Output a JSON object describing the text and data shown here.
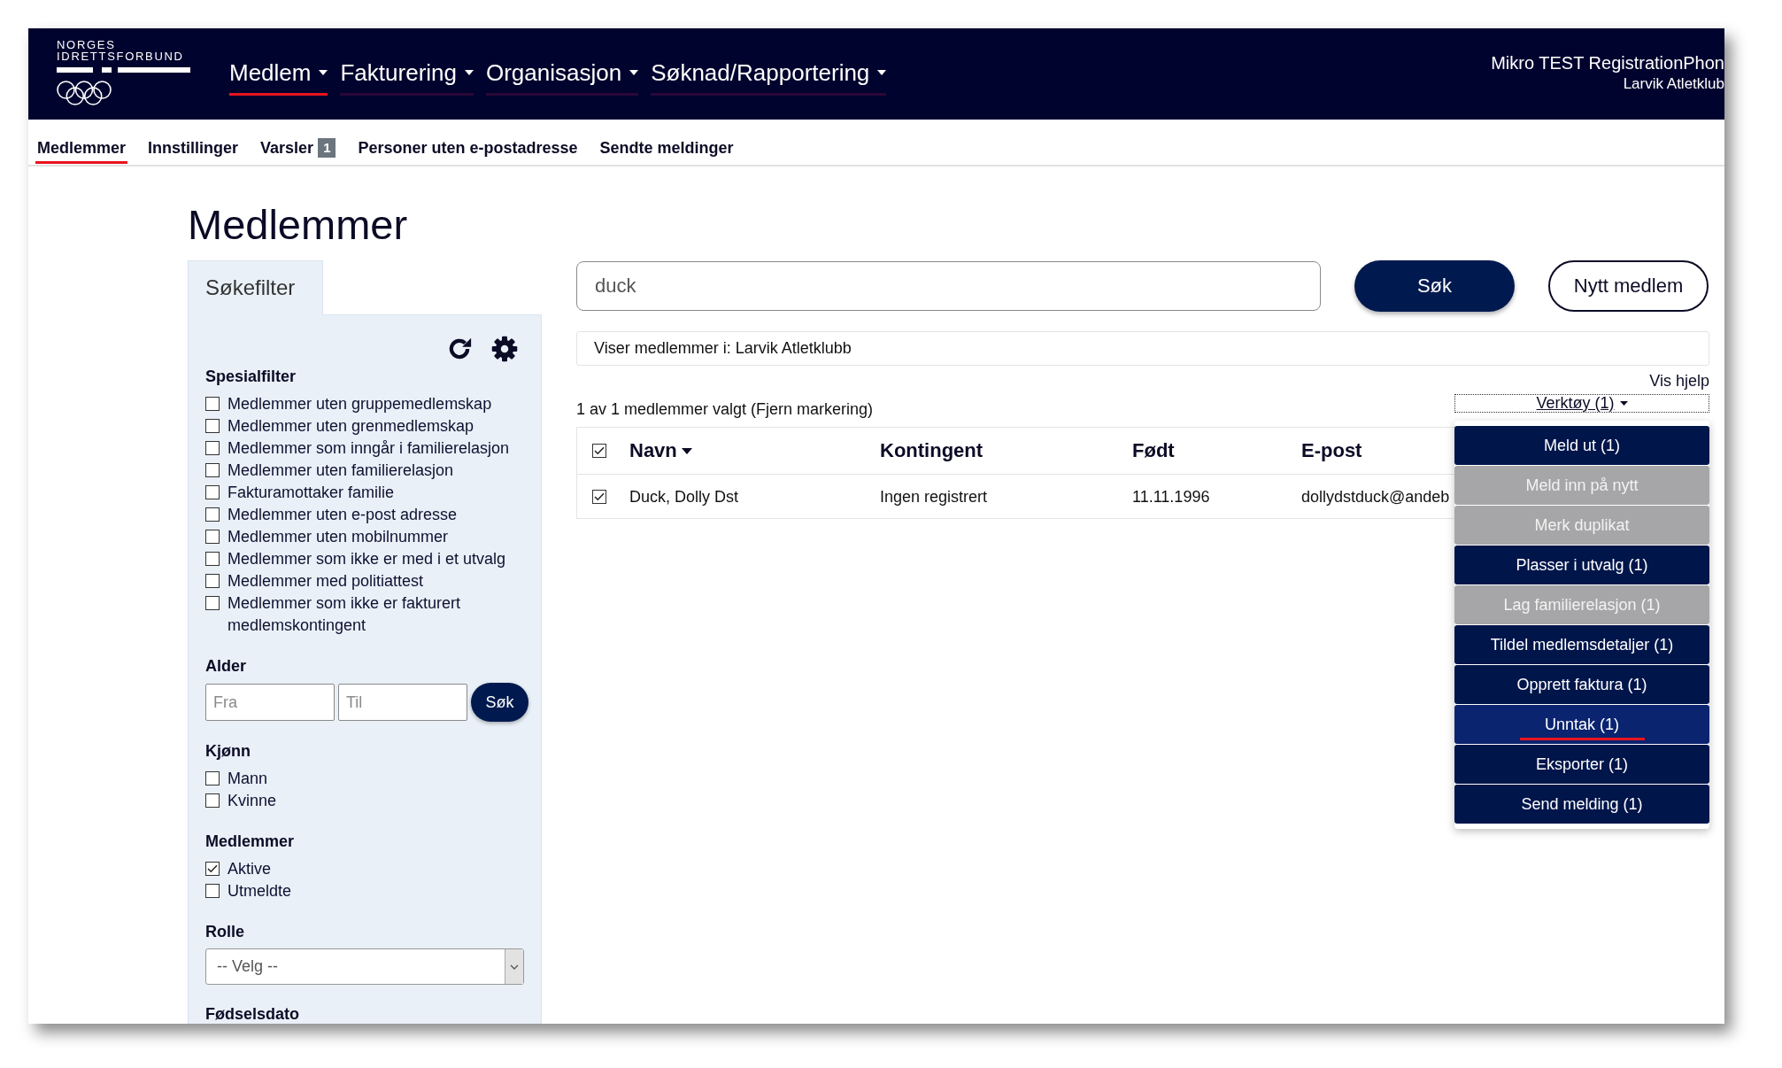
{
  "header": {
    "logo_lines": [
      "NORGES",
      "IDRETTSFORBUND"
    ],
    "nav": [
      {
        "label": "Medlem",
        "selected": true
      },
      {
        "label": "Fakturering",
        "selected": false
      },
      {
        "label": "Organisasjon",
        "selected": false
      },
      {
        "label": "Søknad/Rapportering",
        "selected": false
      }
    ],
    "user_name": "Mikro TEST RegistrationPhon",
    "club_name": "Larvik Atletklub"
  },
  "subnav": [
    {
      "label": "Medlemmer",
      "selected": true
    },
    {
      "label": "Innstillinger",
      "selected": false
    },
    {
      "label": "Varsler",
      "selected": false,
      "badge": "1"
    },
    {
      "label": "Personer uten e-postadresse",
      "selected": false
    },
    {
      "label": "Sendte meldinger",
      "selected": false
    }
  ],
  "page_title": "Medlemmer",
  "filter_panel": {
    "tab": "Søkefilter",
    "sections": [
      {
        "kind": "checkboxes",
        "title": "Spesialfilter",
        "options": [
          {
            "label": "Medlemmer uten gruppemedlemskap",
            "checked": false
          },
          {
            "label": "Medlemmer uten grenmedlemskap",
            "checked": false
          },
          {
            "label": "Medlemmer som inngår i familierelasjon",
            "checked": false
          },
          {
            "label": "Medlemmer uten familierelasjon",
            "checked": false
          },
          {
            "label": "Fakturamottaker familie",
            "checked": false
          },
          {
            "label": "Medlemmer uten e-post adresse",
            "checked": false
          },
          {
            "label": "Medlemmer uten mobilnummer",
            "checked": false
          },
          {
            "label": "Medlemmer som ikke er med i et utvalg",
            "checked": false
          },
          {
            "label": "Medlemmer med politiattest",
            "checked": false
          },
          {
            "label": "Medlemmer som ikke er fakturert medlemskontingent",
            "checked": false
          }
        ]
      },
      {
        "kind": "range",
        "title": "Alder",
        "fields": [
          {
            "placeholder": "Fra"
          },
          {
            "placeholder": "Til"
          }
        ],
        "button": "Søk"
      },
      {
        "kind": "checkboxes",
        "title": "Kjønn",
        "options": [
          {
            "label": "Mann",
            "checked": false
          },
          {
            "label": "Kvinne",
            "checked": false
          }
        ]
      },
      {
        "kind": "checkboxes",
        "title": "Medlemmer",
        "options": [
          {
            "label": "Aktive",
            "checked": true
          },
          {
            "label": "Utmeldte",
            "checked": false
          }
        ]
      },
      {
        "kind": "select",
        "title": "Rolle",
        "value": "-- Velg --"
      },
      {
        "kind": "heading",
        "title": "Fødselsdato"
      }
    ]
  },
  "search": {
    "value": "duck",
    "button": "Søk",
    "new_member_button": "Nytt medlem"
  },
  "scope_notice": "Viser medlemmer i: Larvik Atletklubb",
  "help_link": "Vis hjelp",
  "selection_summary": "1 av 1 medlemmer valgt (Fjern markering)",
  "tools": {
    "label": "Verktøy (1)",
    "expanded": true,
    "items": [
      {
        "label": "Meld ut (1)",
        "disabled": false,
        "selected": false
      },
      {
        "label": "Meld inn på nytt",
        "disabled": true,
        "selected": false
      },
      {
        "label": "Merk duplikat",
        "disabled": true,
        "selected": false
      },
      {
        "label": "Plasser i utvalg (1)",
        "disabled": false,
        "selected": false
      },
      {
        "label": "Lag familierelasjon (1)",
        "disabled": true,
        "selected": false
      },
      {
        "label": "Tildel medlemsdetaljer (1)",
        "disabled": false,
        "selected": false
      },
      {
        "label": "Opprett faktura (1)",
        "disabled": false,
        "selected": false
      },
      {
        "label": "Unntak (1)",
        "disabled": false,
        "selected": true
      },
      {
        "label": "Eksporter (1)",
        "disabled": false,
        "selected": false
      },
      {
        "label": "Send melding (1)",
        "disabled": false,
        "selected": false
      }
    ]
  },
  "table": {
    "select_all": {
      "checked": true
    },
    "columns": [
      {
        "label": "Navn",
        "sorted": true
      },
      {
        "label": "Kontingent",
        "sorted": false
      },
      {
        "label": "Født",
        "sorted": false
      },
      {
        "label": "E-post",
        "sorted": false
      }
    ],
    "rows": [
      {
        "checked": true,
        "cells": [
          "Duck, Dolly Dst",
          "Ingen registrert",
          "11.11.1996",
          "dollydstduck@andeb"
        ]
      }
    ]
  }
}
